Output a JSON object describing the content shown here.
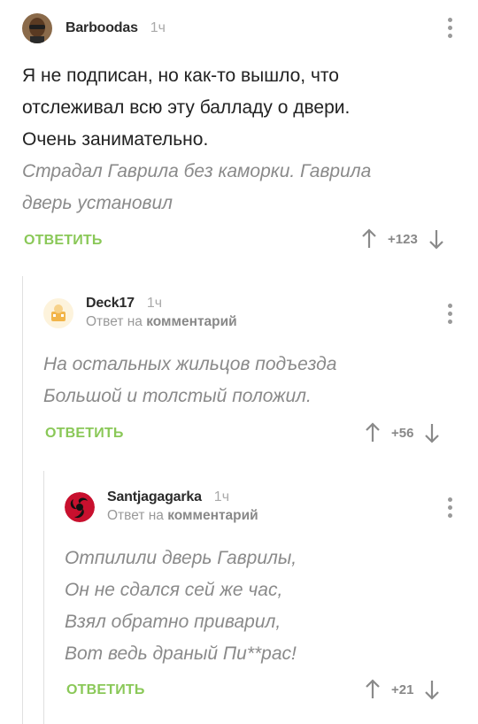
{
  "comments": [
    {
      "author": "Barboodas",
      "time": "1ч",
      "text_lines": [
        "Я не подписан, но как-то вышло, что",
        "отслеживал всю эту балладу о двери.",
        "Очень занимательно."
      ],
      "quote_lines": [
        "Страдал Гаврила без каморки. Гаврила",
        "дверь установил"
      ],
      "reply_label": "ОТВЕТИТЬ",
      "score": "+123"
    },
    {
      "author": "Deck17",
      "time": "1ч",
      "reply_prefix": "Ответ на",
      "reply_target": "комментарий",
      "quote_lines": [
        "На остальных жильцов подъезда",
        "Большой и толстый положил."
      ],
      "reply_label": "ОТВЕТИТЬ",
      "score": "+56"
    },
    {
      "author": "Santjagagarka",
      "time": "1ч",
      "reply_prefix": "Ответ на",
      "reply_target": "комментарий",
      "quote_lines": [
        "Отпилили дверь Гаврилы,",
        "Он не сдался сей же час,",
        "Взял обратно приварил,",
        "Вот ведь драный Пи**рас!"
      ],
      "reply_label": "ОТВЕТИТЬ",
      "score": "+21"
    }
  ],
  "colors": {
    "accent": "#8ac858",
    "muted": "#8a8a8a",
    "line": "#e0e0e0"
  }
}
